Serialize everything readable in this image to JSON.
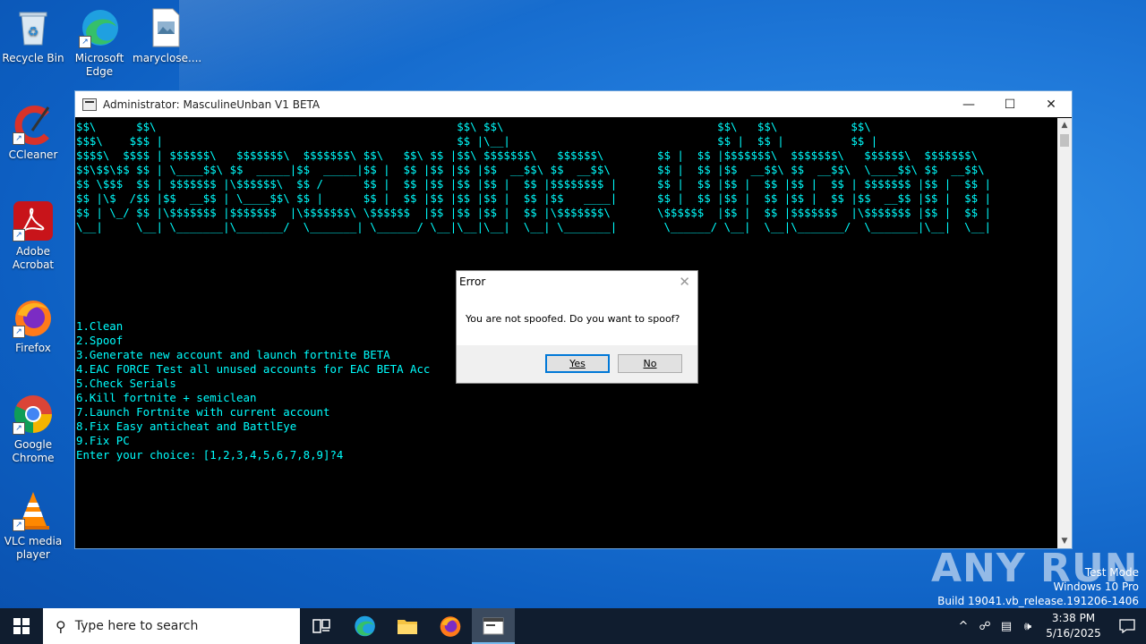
{
  "desktop": {
    "icons": [
      {
        "label": "Recycle Bin"
      },
      {
        "label": "Microsoft Edge"
      },
      {
        "label": "maryclose...."
      },
      {
        "label": "CCleaner"
      },
      {
        "label": "Adobe Acrobat"
      },
      {
        "label": "Firefox"
      },
      {
        "label": "Google Chrome"
      },
      {
        "label": "VLC media player"
      }
    ]
  },
  "console": {
    "title": "Administrator:  MasculineUnban V1 BETA",
    "banner": "$$\\      $$\\                                             $$\\ $$\\                                $$\\   $$\\           $$\\\n$$$\\    $$$ |                                            $$ |\\__|                               $$ |  $$ |          $$ |\n$$$$\\  $$$$ | $$$$$$\\   $$$$$$$\\  $$$$$$$\\ $$\\   $$\\ $$ |$$\\ $$$$$$$\\   $$$$$$\\        $$ |  $$ |$$$$$$$\\  $$$$$$$\\   $$$$$$\\  $$$$$$$\\\n$$\\$$\\$$ $$ | \\____$$\\ $$  _____|$$  _____|$$ |  $$ |$$ |$$ |$$  __$$\\ $$  __$$\\       $$ |  $$ |$$  __$$\\ $$  __$$\\  \\____$$\\ $$  __$$\\\n$$ \\$$$  $$ | $$$$$$$ |\\$$$$$$\\  $$ /      $$ |  $$ |$$ |$$ |$$ |  $$ |$$$$$$$$ |      $$ |  $$ |$$ |  $$ |$$ |  $$ | $$$$$$$ |$$ |  $$ |\n$$ |\\$  /$$ |$$  __$$ | \\____$$\\ $$ |      $$ |  $$ |$$ |$$ |$$ |  $$ |$$   ____|      $$ |  $$ |$$ |  $$ |$$ |  $$ |$$  __$$ |$$ |  $$ |\n$$ | \\_/ $$ |\\$$$$$$$ |$$$$$$$  |\\$$$$$$$\\ \\$$$$$$  |$$ |$$ |$$ |  $$ |\\$$$$$$$\\       \\$$$$$$  |$$ |  $$ |$$$$$$$  |\\$$$$$$$ |$$ |  $$ |\n\\__|     \\__| \\_______|\\_______/  \\_______| \\______/ \\__|\\__|\\__|  \\__| \\_______|       \\______/ \\__|  \\__|\\_______/  \\_______|\\__|  \\__|",
    "menu": [
      "1.Clean",
      "2.Spoof",
      "3.Generate new account and launch fortnite BETA",
      "4.EAC FORCE Test all unused accounts for EAC BETA Acc",
      "5.Check Serials",
      "6.Kill fortnite + semiclean",
      "7.Launch Fortnite with current account",
      "8.Fix Easy anticheat and BattlEye",
      "9.Fix PC",
      "Enter your choice: [1,2,3,4,5,6,7,8,9]?4"
    ]
  },
  "dialog": {
    "title": "Error",
    "message": "You are not spoofed. Do you want to spoof?",
    "yes_label": "Yes",
    "no_label": "No"
  },
  "watermark": {
    "brand": "ANY RUN",
    "line1": "Test Mode",
    "line2": "Windows 10 Pro",
    "line3": "Build 19041.vb_release.191206-1406"
  },
  "taskbar": {
    "search_placeholder": "Type here to search",
    "time": "3:38 PM",
    "date": "5/16/2025"
  },
  "colors": {
    "console_text": "#00ffff",
    "desktop": "#1e77d8",
    "taskbar": "#101d2f"
  }
}
